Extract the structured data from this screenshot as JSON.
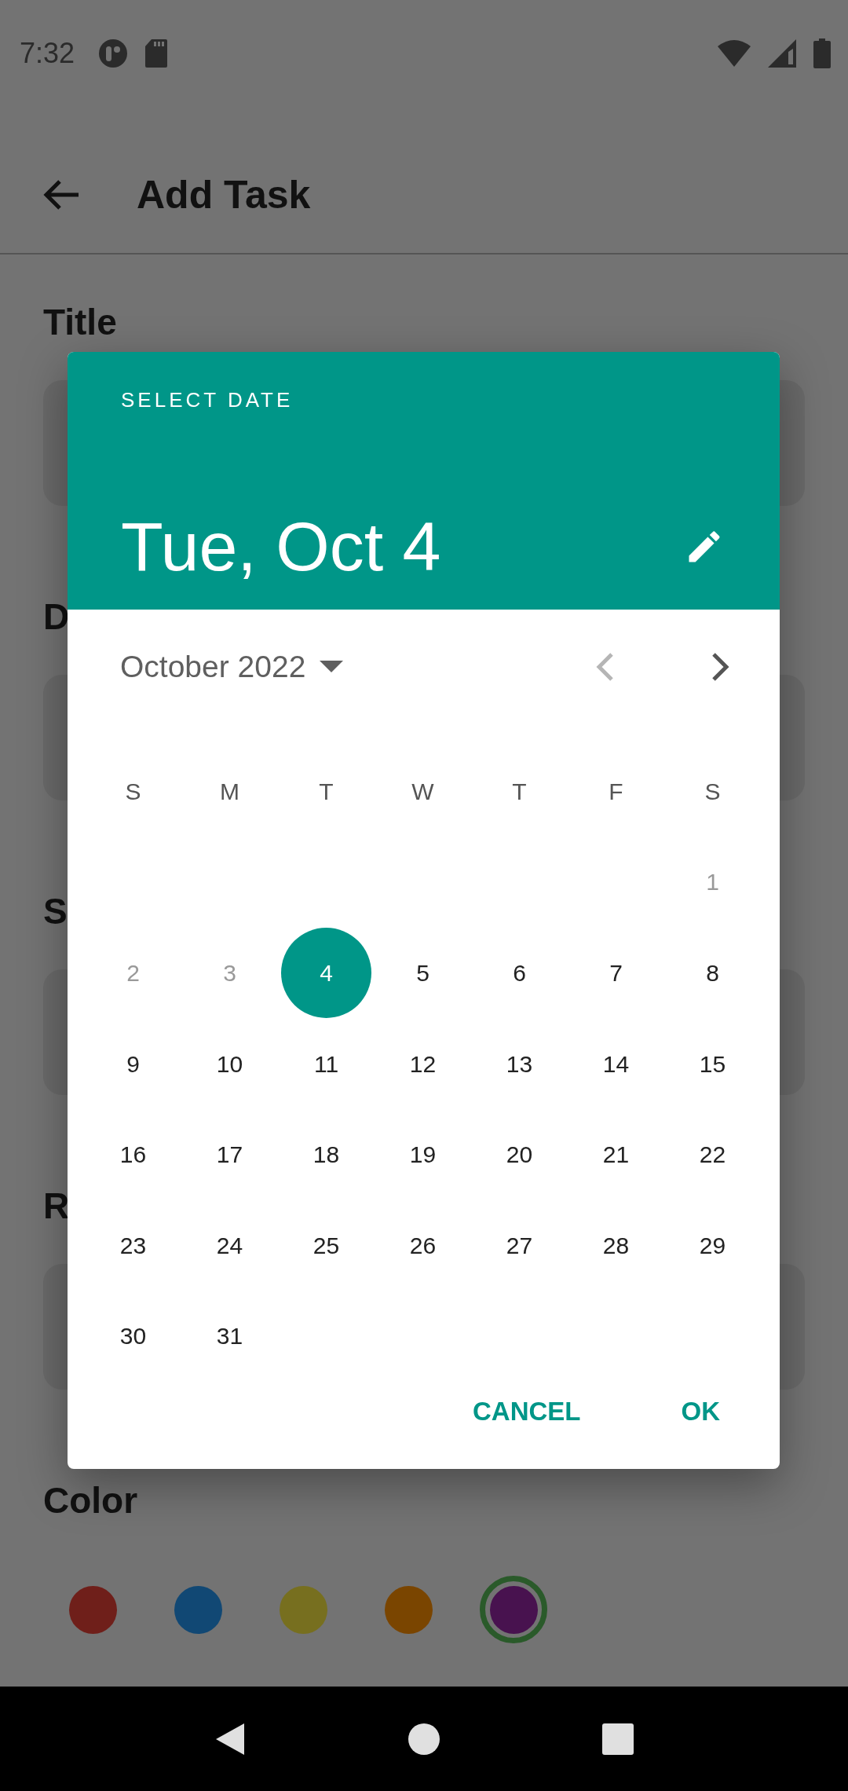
{
  "status_bar": {
    "time": "7:32"
  },
  "toolbar": {
    "title": "Add Task"
  },
  "form": {
    "sections": [
      {
        "label": "Title"
      },
      {
        "label": "D"
      },
      {
        "label": "S"
      },
      {
        "label": "R"
      }
    ],
    "color_label": "Color",
    "colors": [
      {
        "color": "#6f1f1a",
        "selected": false
      },
      {
        "color": "#114874",
        "selected": false
      },
      {
        "color": "#776f1f",
        "selected": false
      },
      {
        "color": "#7a4500",
        "selected": false
      },
      {
        "color": "#48124f",
        "selected": true
      }
    ]
  },
  "dialog": {
    "overline": "SELECT DATE",
    "date": "Tue, Oct 4",
    "month": "October 2022",
    "prev_disabled": true,
    "next_disabled": false,
    "weekdays": [
      "S",
      "M",
      "T",
      "W",
      "T",
      "F",
      "S"
    ],
    "weeks": [
      {
        "days": [
          {
            "kind": "blank"
          },
          {
            "kind": "blank"
          },
          {
            "kind": "blank"
          },
          {
            "kind": "blank"
          },
          {
            "kind": "blank"
          },
          {
            "kind": "blank"
          },
          {
            "kind": "day",
            "label": "1",
            "selected": false,
            "disabled": true
          }
        ]
      },
      {
        "days": [
          {
            "kind": "day",
            "label": "2",
            "selected": false,
            "disabled": true
          },
          {
            "kind": "day",
            "label": "3",
            "selected": false,
            "disabled": true
          },
          {
            "kind": "day",
            "label": "4",
            "selected": true,
            "disabled": false
          },
          {
            "kind": "day",
            "label": "5",
            "selected": false,
            "disabled": false
          },
          {
            "kind": "day",
            "label": "6",
            "selected": false,
            "disabled": false
          },
          {
            "kind": "day",
            "label": "7",
            "selected": false,
            "disabled": false
          },
          {
            "kind": "day",
            "label": "8",
            "selected": false,
            "disabled": false
          }
        ]
      },
      {
        "days": [
          {
            "kind": "day",
            "label": "9",
            "selected": false,
            "disabled": false
          },
          {
            "kind": "day",
            "label": "10",
            "selected": false,
            "disabled": false
          },
          {
            "kind": "day",
            "label": "11",
            "selected": false,
            "disabled": false
          },
          {
            "kind": "day",
            "label": "12",
            "selected": false,
            "disabled": false
          },
          {
            "kind": "day",
            "label": "13",
            "selected": false,
            "disabled": false
          },
          {
            "kind": "day",
            "label": "14",
            "selected": false,
            "disabled": false
          },
          {
            "kind": "day",
            "label": "15",
            "selected": false,
            "disabled": false
          }
        ]
      },
      {
        "days": [
          {
            "kind": "day",
            "label": "16",
            "selected": false,
            "disabled": false
          },
          {
            "kind": "day",
            "label": "17",
            "selected": false,
            "disabled": false
          },
          {
            "kind": "day",
            "label": "18",
            "selected": false,
            "disabled": false
          },
          {
            "kind": "day",
            "label": "19",
            "selected": false,
            "disabled": false
          },
          {
            "kind": "day",
            "label": "20",
            "selected": false,
            "disabled": false
          },
          {
            "kind": "day",
            "label": "21",
            "selected": false,
            "disabled": false
          },
          {
            "kind": "day",
            "label": "22",
            "selected": false,
            "disabled": false
          }
        ]
      },
      {
        "days": [
          {
            "kind": "day",
            "label": "23",
            "selected": false,
            "disabled": false
          },
          {
            "kind": "day",
            "label": "24",
            "selected": false,
            "disabled": false
          },
          {
            "kind": "day",
            "label": "25",
            "selected": false,
            "disabled": false
          },
          {
            "kind": "day",
            "label": "26",
            "selected": false,
            "disabled": false
          },
          {
            "kind": "day",
            "label": "27",
            "selected": false,
            "disabled": false
          },
          {
            "kind": "day",
            "label": "28",
            "selected": false,
            "disabled": false
          },
          {
            "kind": "day",
            "label": "29",
            "selected": false,
            "disabled": false
          }
        ]
      },
      {
        "days": [
          {
            "kind": "day",
            "label": "30",
            "selected": false,
            "disabled": false
          },
          {
            "kind": "day",
            "label": "31",
            "selected": false,
            "disabled": false
          }
        ]
      }
    ],
    "buttons": [
      "CANCEL",
      "OK"
    ]
  }
}
